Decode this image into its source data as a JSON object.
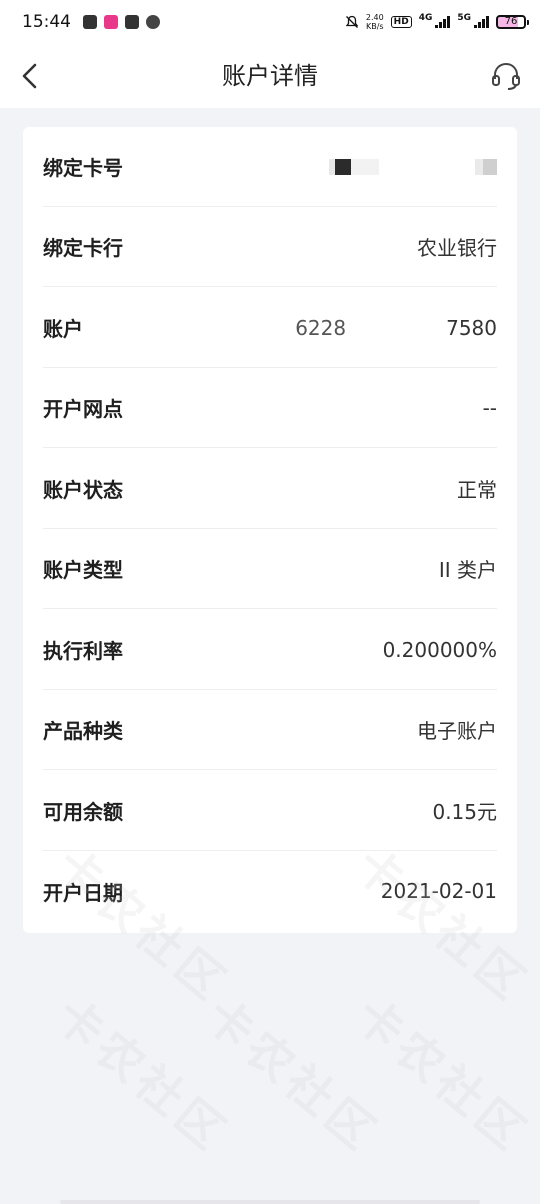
{
  "status": {
    "time": "15:44",
    "net_speed_value": "2.40",
    "net_speed_unit": "KB/s",
    "hd_label": "HD",
    "sim1_label": "4G",
    "sim2_label": "5G",
    "battery": "76"
  },
  "nav": {
    "title": "账户详情"
  },
  "details": [
    {
      "label": "绑定卡号",
      "value": ""
    },
    {
      "label": "绑定卡行",
      "value": "农业银行"
    },
    {
      "label": "账户",
      "value": ""
    },
    {
      "label": "开户网点",
      "value": "--"
    },
    {
      "label": "账户状态",
      "value": "正常"
    },
    {
      "label": "账户类型",
      "value": "II 类户"
    },
    {
      "label": "执行利率",
      "value": "0.200000%"
    },
    {
      "label": "产品种类",
      "value": "电子账户"
    },
    {
      "label": "可用余额",
      "value": "0.15元"
    },
    {
      "label": "开户日期",
      "value": "2021-02-01"
    }
  ],
  "masked": {
    "account_prefix": "6228",
    "account_suffix": "7580"
  },
  "watermark_text": "卡农社区",
  "colors": {
    "background": "#f2f3f7",
    "card": "#ffffff",
    "battery_fill": "#f5b8e6"
  }
}
